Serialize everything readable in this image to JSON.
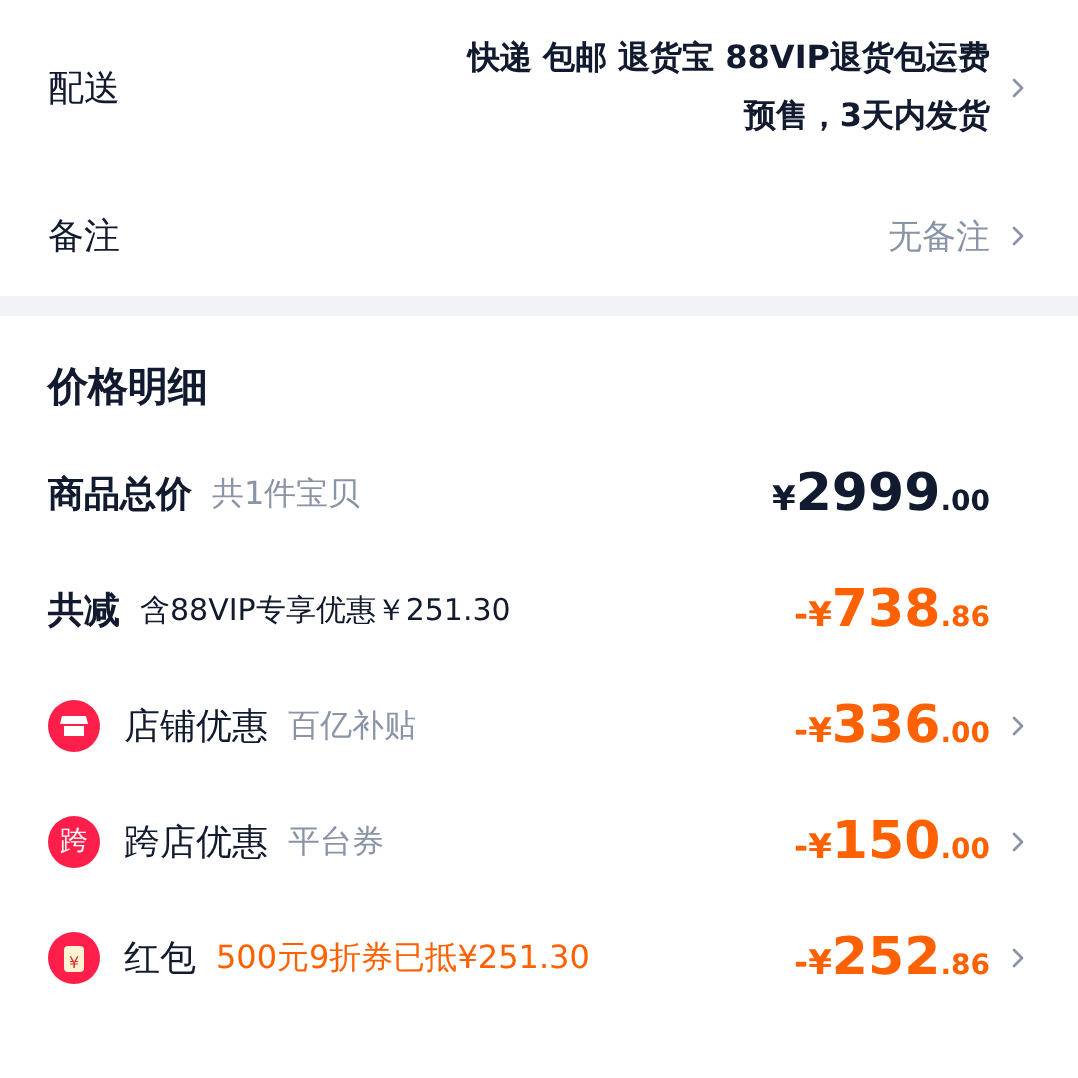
{
  "delivery": {
    "label": "配送",
    "lines": [
      "快递 包邮 退货宝 88VIP退货包运费",
      "预售，3天内发货"
    ]
  },
  "remark": {
    "label": "备注",
    "value": "无备注"
  },
  "price_detail": {
    "title": "价格明细",
    "rows": [
      {
        "kind": "subtotal",
        "label": "商品总价",
        "note": "共1件宝贝",
        "note_highlight": false,
        "discount": false,
        "chevron": false,
        "sign": "¥",
        "integer": "2999",
        "decimal": ".00"
      },
      {
        "kind": "reduction",
        "label": "共减",
        "note": "含88VIP专享优惠￥251.30",
        "note_highlight": false,
        "discount": true,
        "chevron": false,
        "sign": "-¥",
        "integer": "738",
        "decimal": ".86"
      },
      {
        "kind": "store",
        "label": "店铺优惠",
        "note": "百亿补贴",
        "note_highlight": false,
        "discount": true,
        "chevron": true,
        "sign": "-¥",
        "integer": "336",
        "decimal": ".00"
      },
      {
        "kind": "glyph",
        "glyph": "跨",
        "label": "跨店优惠",
        "note": "平台券",
        "note_highlight": false,
        "discount": true,
        "chevron": true,
        "sign": "-¥",
        "integer": "150",
        "decimal": ".00"
      },
      {
        "kind": "envelope",
        "glyph": "¥",
        "label": "红包",
        "note": "500元9折券已抵¥251.30",
        "note_highlight": true,
        "discount": true,
        "chevron": true,
        "sign": "-¥",
        "integer": "252",
        "decimal": ".86"
      }
    ]
  }
}
